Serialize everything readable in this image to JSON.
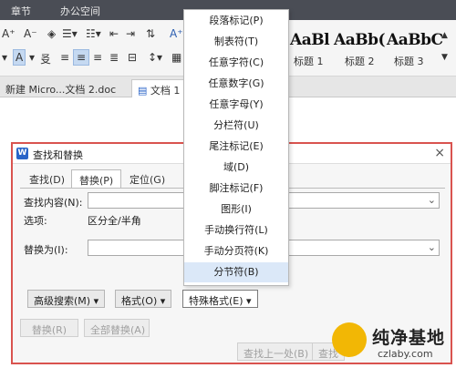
{
  "top_menu": {
    "items": [
      "章节",
      "办公空间"
    ]
  },
  "ribbon": {
    "styles": [
      {
        "preview": "AaBl",
        "label": "标题 1"
      },
      {
        "preview": "AaBb(",
        "label": "标题 2"
      },
      {
        "preview": "AaBbC",
        "label": "标题 3"
      }
    ]
  },
  "doc_tabs": [
    "新建 Micro...文档 2.doc",
    "文档 1"
  ],
  "dialog": {
    "title": "查找和替换",
    "close_glyph": "×",
    "tabs": [
      "查找(D)",
      "替换(P)",
      "定位(G)"
    ],
    "find_label": "查找内容(N):",
    "find_value": "",
    "options_label": "选项:",
    "options_value": "区分全/半角",
    "replace_label": "替换为(I):",
    "replace_value": "",
    "buttons": {
      "advanced_search": "高级搜索(M) ▾",
      "format": "格式(O) ▾",
      "special_format": "特殊格式(E) ▾",
      "replace": "替换(R)",
      "replace_all": "全部替换(A)",
      "find_prev": "查找上一处(B)",
      "find_next": "查找"
    }
  },
  "special_menu": {
    "items": [
      "段落标记(P)",
      "制表符(T)",
      "任意字符(C)",
      "任意数字(G)",
      "任意字母(Y)",
      "分栏符(U)",
      "尾注标记(E)",
      "域(D)",
      "脚注标记(F)",
      "图形(I)",
      "手动换行符(L)",
      "手动分页符(K)",
      "分节符(B)"
    ]
  },
  "watermark": {
    "title": "纯净基地",
    "url": "czlaby.com"
  },
  "colors": {
    "dialog_border": "#d9534f",
    "menu_hover": "#dbe8f8",
    "topbar": "#4a4d55",
    "brand_blue": "#2a64c8"
  }
}
